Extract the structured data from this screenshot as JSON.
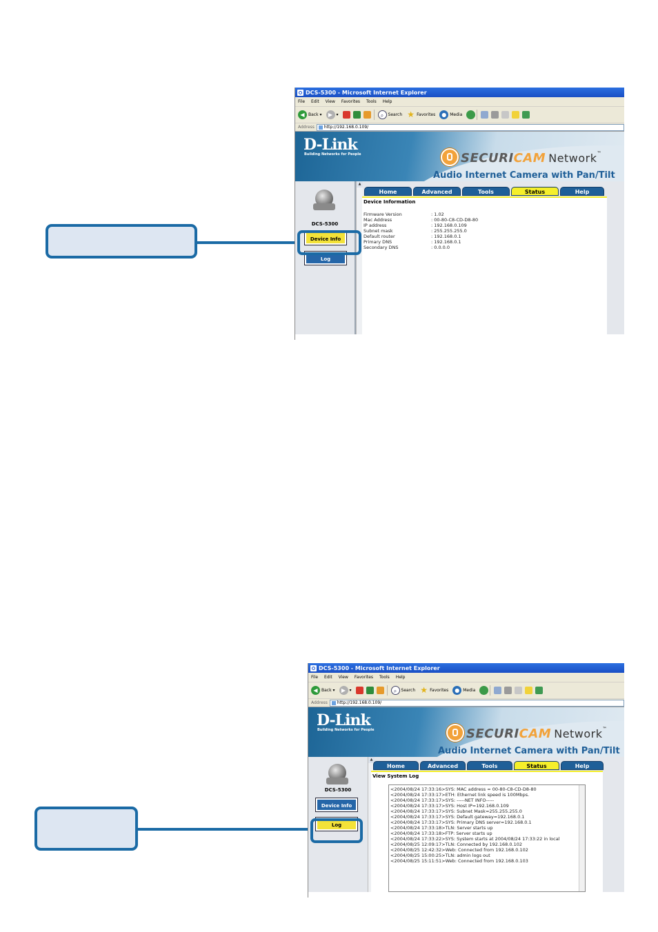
{
  "browser": {
    "title": "DCS-5300 - Microsoft Internet Explorer",
    "menu": [
      "File",
      "Edit",
      "View",
      "Favorites",
      "Tools",
      "Help"
    ],
    "back_label": "Back",
    "search_label": "Search",
    "favorites_label": "Favorites",
    "media_label": "Media",
    "address_label": "Address",
    "url": "http://192.168.0.109/"
  },
  "banner": {
    "brand": "D-Link",
    "tagline": "Building Networks for People",
    "securi": "SECURI",
    "cam": "CAM",
    "network": "Network",
    "tm": "™",
    "product": "Audio Internet Camera with Pan/Tilt"
  },
  "sidebar": {
    "model": "DCS-5300",
    "device_info": "Device Info",
    "log": "Log"
  },
  "tabs": [
    "Home",
    "Advanced",
    "Tools",
    "Status",
    "Help"
  ],
  "active_tab": "Status",
  "device_info": {
    "title": "Device Information",
    "rows": [
      {
        "label": "Firmware Version",
        "value": ": 1.02"
      },
      {
        "label": "Mac Address",
        "value": ": 00-80-C8-CD-D8-80"
      },
      {
        "label": "IP address",
        "value": ": 192.168.0.109"
      },
      {
        "label": "Subnet mask",
        "value": ": 255.255.255.0"
      },
      {
        "label": "Default router",
        "value": ": 192.168.0.1"
      },
      {
        "label": "Primary DNS",
        "value": ": 192.168.0.1"
      },
      {
        "label": "Secondary DNS",
        "value": ": 0.0.0.0"
      }
    ]
  },
  "system_log": {
    "title": "View System Log",
    "lines": [
      "<2004/08/24 17:33:16>SYS: MAC address = 00-80-C8-CD-D8-80",
      "<2004/08/24 17:33:17>ETH: Ethernet link speed is 100Mbps.",
      "<2004/08/24 17:33:17>SYS: -----NET INFO-----",
      "<2004/08/24 17:33:17>SYS: Host IP=192.168.0.109",
      "<2004/08/24 17:33:17>SYS: Subnet Mask=255.255.255.0",
      "<2004/08/24 17:33:17>SYS: Default gateway=192.168.0.1",
      "<2004/08/24 17:33:17>SYS: Primary DNS server=192.168.0.1",
      "<2004/08/24 17:33:18>TLN: Server starts up",
      "<2004/08/24 17:33:18>FTP: Server starts up",
      "<2004/08/24 17:33:22>SYS: System starts at 2004/08/24 17:33:22 in local",
      "<2004/08/25 12:09:17>TLN: Connected by 192.168.0.102",
      "<2004/08/25 12:42:32>Web: Connected from 192.168.0.102",
      "<2004/08/25 15:00:25>TLN: admin logs out",
      "<2004/08/25 15:11:51>Web: Connected from 192.168.0.103"
    ]
  }
}
